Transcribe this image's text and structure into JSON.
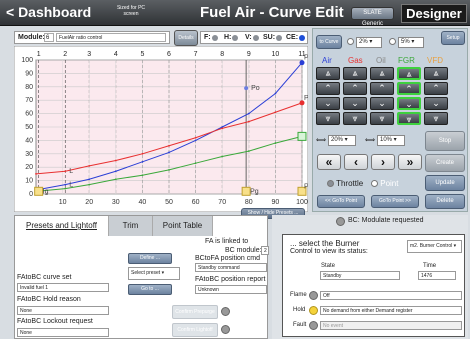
{
  "header": {
    "back_label": "< Dashboard",
    "font_note": "Sized for PC screen",
    "title": "Fuel Air - Curve Edit",
    "slate_label": "SLATE Generic",
    "designer_label": "Designer"
  },
  "module": {
    "label": "Module:",
    "number": "6",
    "name": "FuelAir ratio control",
    "details_label": "Details"
  },
  "legend": [
    {
      "key": "F:",
      "color": "#8a8f96"
    },
    {
      "key": "H:",
      "color": "#8a8f96"
    },
    {
      "key": "V:",
      "color": "#8a8f96"
    },
    {
      "key": "SU:",
      "color": "#8a8f96"
    },
    {
      "key": "CE:",
      "color": "#1e4fd8"
    }
  ],
  "chart_data": {
    "type": "line",
    "x_ticks_top": [
      "1",
      "2",
      "3",
      "4",
      "5",
      "6",
      "7",
      "8",
      "9",
      "10",
      "11"
    ],
    "x_ticks_bottom": [
      "10",
      "20",
      "30",
      "40",
      "50",
      "60",
      "70",
      "80",
      "90",
      "100"
    ],
    "y_ticks": [
      "100",
      "90",
      "80",
      "70",
      "60",
      "50",
      "40",
      "30",
      "20",
      "10",
      "0"
    ],
    "xlim": [
      0,
      100
    ],
    "ylim": [
      0,
      100
    ],
    "grid": true,
    "series": [
      {
        "name": "Air",
        "color": "#2b3fd6",
        "x": [
          0,
          11,
          20,
          30,
          40,
          50,
          60,
          70,
          80,
          90,
          100
        ],
        "y": [
          3,
          7,
          11,
          17,
          24,
          31,
          40,
          50,
          60,
          75,
          98
        ]
      },
      {
        "name": "Gas",
        "color": "#e83030",
        "x": [
          0,
          11,
          20,
          30,
          40,
          50,
          60,
          70,
          80,
          90,
          100
        ],
        "y": [
          15,
          17,
          21,
          25,
          30,
          36,
          42,
          49,
          54,
          61,
          68
        ]
      },
      {
        "name": "FGR",
        "color": "#3aa83a",
        "x": [
          0,
          11,
          20,
          30,
          40,
          50,
          60,
          70,
          80,
          90,
          100
        ],
        "y": [
          2,
          4,
          7,
          11,
          14,
          18,
          23,
          28,
          32,
          38,
          43
        ]
      }
    ],
    "annotations": [
      {
        "text": "P",
        "x": 100,
        "y": 98
      },
      {
        "text": "Po",
        "x": 79,
        "y": 79
      },
      {
        "text": "L",
        "x": 11,
        "y": 17
      },
      {
        "text": "L",
        "x": 11,
        "y": 7
      },
      {
        "text": "P",
        "x": 100,
        "y": 68
      },
      {
        "text": "Ig",
        "x": 1,
        "y": 2
      },
      {
        "text": "Pg",
        "x": 79,
        "y": 2
      },
      {
        "text": "P",
        "x": 100,
        "y": 2
      }
    ],
    "marker_x": 79
  },
  "control": {
    "to_curve_label": "to Curve",
    "pct1": "2%",
    "pct2": "5%",
    "setup_label": "Setup",
    "fuel_headers": [
      {
        "label": "Air",
        "color": "#2b3fd6"
      },
      {
        "label": "Gas",
        "color": "#e83030"
      },
      {
        "label": "Oil",
        "color": "#888888"
      },
      {
        "label": "FGR",
        "color": "#3aa83a"
      },
      {
        "label": "VFD",
        "color": "#e8a040"
      }
    ],
    "step1": "20%",
    "step2": "10%",
    "stop_label": "Stop",
    "create_label": "Create",
    "update_label": "Update",
    "delete_label": "Delete",
    "throttle_label": "Throttle",
    "point_label": "Point",
    "goto_prev": "<< GoTo Point",
    "goto_next": "GoTo Point >>",
    "show_hide_presets": "Show / Hide Presets ..."
  },
  "tabs": [
    "Presets and Lightoff",
    "Trim",
    "Point Table"
  ],
  "left_panel": {
    "fa_linked": "FA is linked to",
    "bc_module": "BC module:",
    "bc_module_num": "2",
    "define_label": "Define ...",
    "select_preset": "Select preset",
    "goto_label": "Go to ...",
    "curve_set_label": "FAtoBC curve set",
    "curve_set_value": "Invalid fuel 1",
    "hold_label": "FAtoBC Hold reason",
    "hold_value": "None",
    "lockout_label": "FAtoBC Lockout request",
    "lockout_value": "None",
    "pos_cmd_label": "BCtoFA position cmd",
    "pos_cmd_value": "Standby command",
    "pos_report_label": "FAtoBC position report",
    "pos_report_value": "Unknown",
    "confirm_prepurge": "Confirm Prepurge",
    "confirm_lightoff": "Confirm Lightoff"
  },
  "right_panel": {
    "bc_status": "BC: Modulate requested",
    "select_burner": "... select the Burner",
    "control_view": "Control to view its status:",
    "burner_select": "m2. Burner Control",
    "state_label": "State",
    "time_label": "Time",
    "state_value": "Standby",
    "time_value": "1476",
    "flame_label": "Flame",
    "flame_value": "Off",
    "hold_label": "Hold",
    "hold_value": "No demand from either Demand register",
    "fault_label": "Fault",
    "fault_value": "No event"
  }
}
